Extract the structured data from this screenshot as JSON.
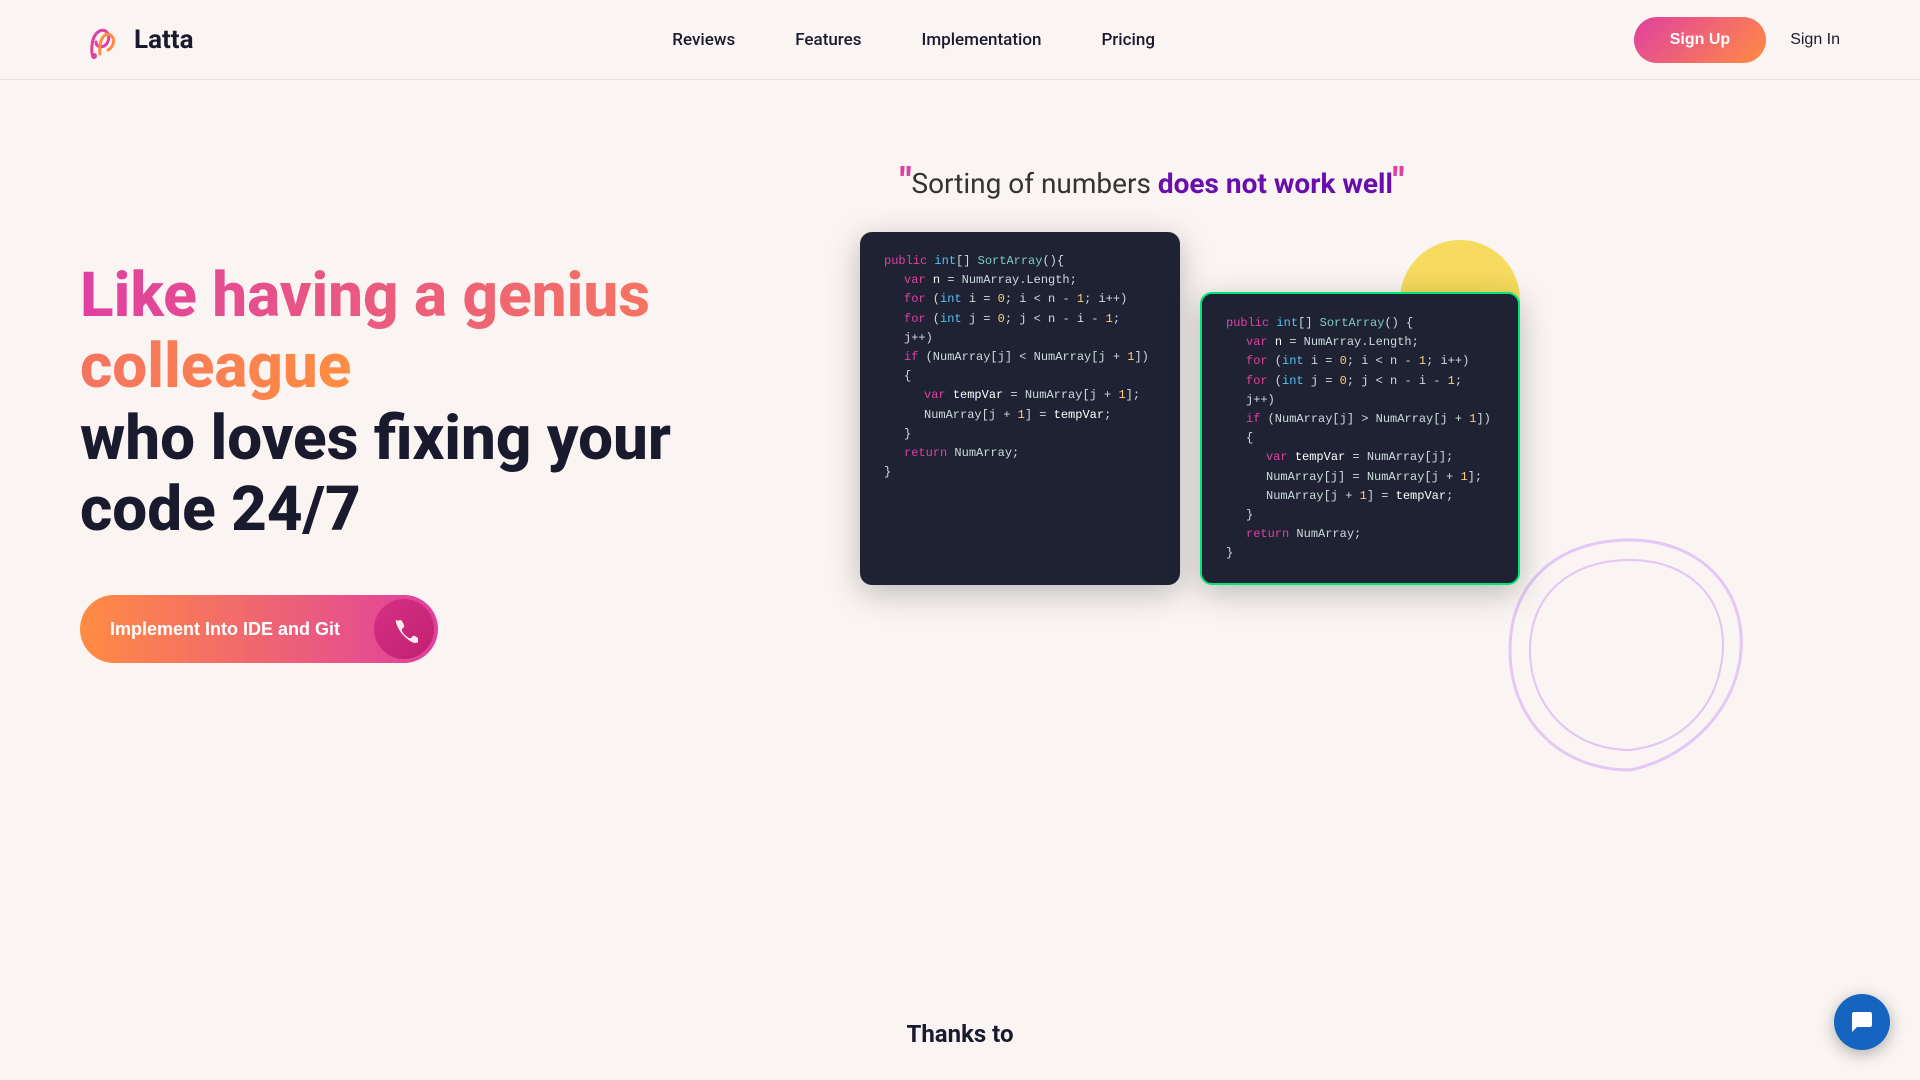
{
  "header": {
    "logo_text": "Latta",
    "nav": {
      "reviews": "Reviews",
      "features": "Features",
      "implementation": "Implementation",
      "pricing": "Pricing"
    },
    "signup_label": "Sign Up",
    "signin_label": "Sign In"
  },
  "hero": {
    "title_part1": "Like having a genius colleague",
    "title_part2": "who loves fixing your code 24/7",
    "cta_label": "Implement Into IDE and Git",
    "quote_prefix": "“",
    "quote_text": "Sorting of numbers ",
    "quote_emphasis": "does not work well",
    "quote_suffix": "”"
  },
  "code_block_1": {
    "lines": [
      "public int[] SortArray(){",
      "    var n = NumArray.Length;",
      "    for (int i = 0; i < n - 1; i++)",
      "    for (int j = 0; j < n - i - 1; j++)",
      "    if (NumArray[j] < NumArray[j + 1]) {",
      "        var tempVar = NumArray[j + 1];",
      "        NumArray[j + 1] = tempVar;",
      "    }",
      "    return NumArray;",
      "}"
    ]
  },
  "code_block_2": {
    "lines": [
      "public int[] SortArray() {",
      "    var n = NumArray.Length;",
      "    for (int i = 0; i < n - 1; i++)",
      "    for (int j = 0; j < n - i - 1; j++)",
      "    if (NumArray[j] > NumArray[j + 1]) {",
      "        var tempVar = NumArray[j];",
      "        NumArray[j] = NumArray[j + 1];",
      "        NumArray[j + 1] = tempVar;",
      "    }",
      "    return NumArray;",
      "}"
    ]
  },
  "footer": {
    "thanks_label": "Thanks to"
  },
  "colors": {
    "gradient_start": "#e040a0",
    "gradient_end": "#ff8c42",
    "accent_purple": "#6a0dad",
    "code_bg": "#1e2233",
    "correct_border": "#00e676"
  }
}
